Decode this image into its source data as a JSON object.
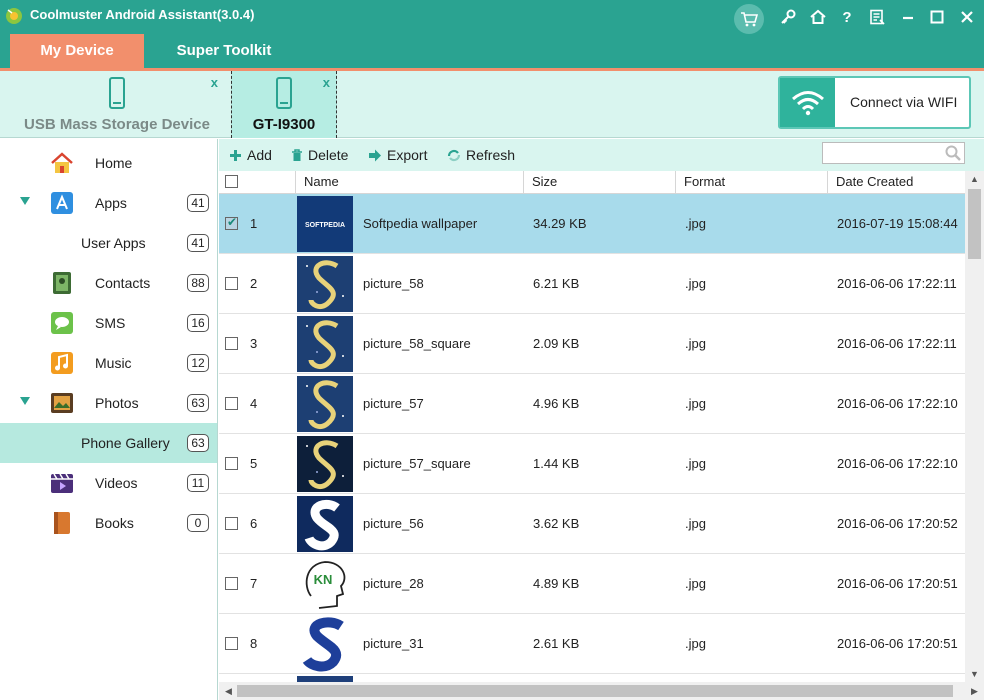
{
  "app": {
    "title": "Coolmuster Android Assistant(3.0.4)"
  },
  "header_icons": [
    "cart-icon",
    "key-icon",
    "home-icon",
    "help-icon",
    "feedback-icon",
    "minimize-icon",
    "maximize-icon",
    "close-icon"
  ],
  "help_glyph": "?",
  "tabs": [
    {
      "label": "My Device",
      "active": true
    },
    {
      "label": "Super Toolkit",
      "active": false
    }
  ],
  "devices": [
    {
      "label": "USB Mass Storage Device",
      "close": "x",
      "active": false
    },
    {
      "label": "GT-I9300",
      "close": "x",
      "active": true
    }
  ],
  "wifi": {
    "label": "Connect via WIFI"
  },
  "sidebar": {
    "items": [
      {
        "label": "Home",
        "count": "",
        "icon": "home-icon",
        "expanded": false,
        "sub": false,
        "active": false
      },
      {
        "label": "Apps",
        "count": "41",
        "icon": "apps-icon",
        "expanded": true,
        "sub": false,
        "active": false
      },
      {
        "label": "User Apps",
        "count": "41",
        "icon": "",
        "expanded": false,
        "sub": true,
        "active": false
      },
      {
        "label": "Contacts",
        "count": "88",
        "icon": "contacts-icon",
        "expanded": false,
        "sub": false,
        "active": false
      },
      {
        "label": "SMS",
        "count": "16",
        "icon": "sms-icon",
        "expanded": false,
        "sub": false,
        "active": false
      },
      {
        "label": "Music",
        "count": "12",
        "icon": "music-icon",
        "expanded": false,
        "sub": false,
        "active": false
      },
      {
        "label": "Photos",
        "count": "63",
        "icon": "photos-icon",
        "expanded": true,
        "sub": false,
        "active": false
      },
      {
        "label": "Phone Gallery",
        "count": "63",
        "icon": "",
        "expanded": false,
        "sub": true,
        "active": true
      },
      {
        "label": "Videos",
        "count": "11",
        "icon": "videos-icon",
        "expanded": false,
        "sub": false,
        "active": false
      },
      {
        "label": "Books",
        "count": "0",
        "icon": "books-icon",
        "expanded": false,
        "sub": false,
        "active": false
      }
    ]
  },
  "toolbar": {
    "add": "Add",
    "delete": "Delete",
    "export": "Export",
    "refresh": "Refresh",
    "search_placeholder": ""
  },
  "table": {
    "columns": [
      "Name",
      "Size",
      "Format",
      "Date Created"
    ],
    "rows": [
      {
        "index": "1",
        "name": "Softpedia wallpaper",
        "size": "34.29 KB",
        "format": ".jpg",
        "date": "2016-07-19 15:08:44",
        "selected": true,
        "thumb": "softpedia",
        "thumb_text": "SOFTPEDIA"
      },
      {
        "index": "2",
        "name": "picture_58",
        "size": "6.21 KB",
        "format": ".jpg",
        "date": "2016-06-06 17:22:11",
        "selected": false,
        "thumb": "sparkle-s"
      },
      {
        "index": "3",
        "name": "picture_58_square",
        "size": "2.09 KB",
        "format": ".jpg",
        "date": "2016-06-06 17:22:11",
        "selected": false,
        "thumb": "sparkle-s"
      },
      {
        "index": "4",
        "name": "picture_57",
        "size": "4.96 KB",
        "format": ".jpg",
        "date": "2016-06-06 17:22:10",
        "selected": false,
        "thumb": "sparkle-s"
      },
      {
        "index": "5",
        "name": "picture_57_square",
        "size": "1.44 KB",
        "format": ".jpg",
        "date": "2016-06-06 17:22:10",
        "selected": false,
        "thumb": "sparkle-s-dark"
      },
      {
        "index": "6",
        "name": "picture_56",
        "size": "3.62 KB",
        "format": ".jpg",
        "date": "2016-06-06 17:20:52",
        "selected": false,
        "thumb": "white-s"
      },
      {
        "index": "7",
        "name": "picture_28",
        "size": "4.89 KB",
        "format": ".jpg",
        "date": "2016-06-06 17:20:51",
        "selected": false,
        "thumb": "head",
        "thumb_text": "KN"
      },
      {
        "index": "8",
        "name": "picture_31",
        "size": "2.61 KB",
        "format": ".jpg",
        "date": "2016-06-06 17:20:51",
        "selected": false,
        "thumb": "blue-s"
      }
    ]
  },
  "colors": {
    "teal": "#2aa391",
    "orange": "#f28f6c",
    "selected_row": "#a8dbeb",
    "light_teal": "#d9f5ef"
  }
}
